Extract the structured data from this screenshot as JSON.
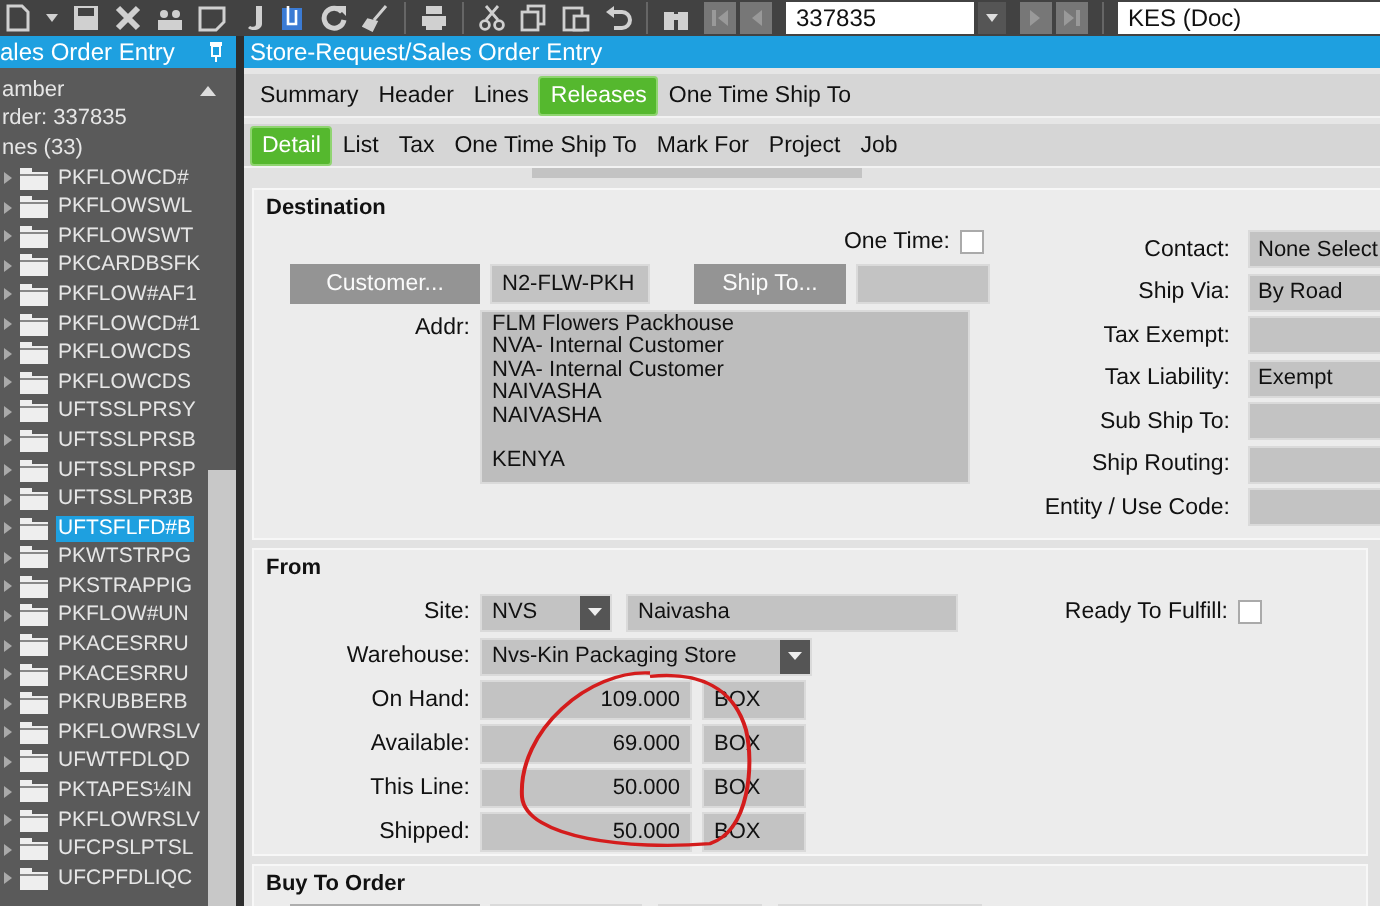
{
  "toolbar": {
    "order_number": "337835",
    "company": "KES (Doc)"
  },
  "sidebar": {
    "title": "ales Order Entry",
    "tree": [
      {
        "label": "amber",
        "children": [
          {
            "label": "rder: 337835",
            "children": [
              {
                "label": "nes (33)",
                "children": [
                  {
                    "label": "PKFLOWCD#",
                    "selected": false
                  },
                  {
                    "label": "PKFLOWSWL",
                    "selected": false
                  },
                  {
                    "label": "PKFLOWSWT",
                    "selected": false
                  },
                  {
                    "label": "PKCARDBSFK",
                    "selected": false
                  },
                  {
                    "label": "PKFLOW#AF1",
                    "selected": false
                  },
                  {
                    "label": "PKFLOWCD#1",
                    "selected": false
                  },
                  {
                    "label": "PKFLOWCDS",
                    "selected": false
                  },
                  {
                    "label": "PKFLOWCDS",
                    "selected": false
                  },
                  {
                    "label": "UFTSSLPRSY",
                    "selected": false
                  },
                  {
                    "label": "UFTSSLPRSB",
                    "selected": false
                  },
                  {
                    "label": "UFTSSLPRSP",
                    "selected": false
                  },
                  {
                    "label": "UFTSSLPR3B",
                    "selected": false
                  },
                  {
                    "label": "UFTSFLFD#B",
                    "selected": true
                  },
                  {
                    "label": "PKWTSTRPG",
                    "selected": false
                  },
                  {
                    "label": "PKSTRAPPIG",
                    "selected": false
                  },
                  {
                    "label": "PKFLOW#UN",
                    "selected": false
                  },
                  {
                    "label": "PKACESRRU",
                    "selected": false
                  },
                  {
                    "label": "PKACESRRU",
                    "selected": false
                  },
                  {
                    "label": "PKRUBBERB",
                    "selected": false
                  },
                  {
                    "label": "PKFLOWRSLV",
                    "selected": false
                  },
                  {
                    "label": "UFWTFDLQD",
                    "selected": false
                  },
                  {
                    "label": "PKTAPES½IN",
                    "selected": false
                  },
                  {
                    "label": "PKFLOWRSLV",
                    "selected": false
                  },
                  {
                    "label": "UFCPSLPTSL",
                    "selected": false
                  },
                  {
                    "label": "UFCPFDLIQC",
                    "selected": false
                  }
                ]
              }
            ]
          }
        ]
      }
    ]
  },
  "window": {
    "title": "Store-Request/Sales Order Entry"
  },
  "tabs": [
    {
      "label": "Summary",
      "selected": false
    },
    {
      "label": "Header",
      "selected": false
    },
    {
      "label": "Lines",
      "selected": false
    },
    {
      "label": "Releases",
      "selected": true
    },
    {
      "label": "One Time Ship To",
      "selected": false
    }
  ],
  "subtabs": [
    {
      "label": "Detail",
      "selected": true
    },
    {
      "label": "List",
      "selected": false
    },
    {
      "label": "Tax",
      "selected": false
    },
    {
      "label": "One Time Ship To",
      "selected": false
    },
    {
      "label": "Mark For",
      "selected": false
    },
    {
      "label": "Project",
      "selected": false
    },
    {
      "label": "Job",
      "selected": false
    }
  ],
  "destination": {
    "heading": "Destination",
    "one_time": {
      "label": "One Time:",
      "checked": false
    },
    "customer_button": {
      "label": "Customer...",
      "disabled": true
    },
    "customer_id": "N2-FLW-PKH",
    "ship_to_button": {
      "label": "Ship To...",
      "disabled": true
    },
    "address_label": "Addr:",
    "address": "FLM Flowers Packhouse\nNVA- Internal Customer\nNVA- Internal Customer\nNAIVASHA\nNAIVASHA\n\nKENYA",
    "fields": [
      {
        "label": "Contact:",
        "value": "None Select"
      },
      {
        "label": "Ship Via:",
        "value": "By Road"
      },
      {
        "label": "Tax Exempt:"
      },
      {
        "label": "Tax Liability:",
        "value": "Exempt"
      },
      {
        "label": "Sub Ship To:"
      },
      {
        "label": "Ship Routing:"
      },
      {
        "label": "Entity / Use Code:"
      }
    ]
  },
  "from": {
    "heading": "From",
    "site": {
      "label": "Site:",
      "value": "NVS",
      "description": "Naivasha"
    },
    "warehouse": {
      "label": "Warehouse:",
      "value": "Nvs-Kin Packaging Store"
    },
    "ready_to_fulfill": {
      "label": "Ready To Fulfill:",
      "checked": false
    },
    "quantities": [
      {
        "label": "On Hand:",
        "value": "109.000",
        "unit": "BOX"
      },
      {
        "label": "Available:",
        "value": "69.000",
        "unit": "BOX"
      },
      {
        "label": "This Line:",
        "value": "50.000",
        "unit": "BOX"
      },
      {
        "label": "Shipped:",
        "value": "50.000",
        "unit": "BOX"
      }
    ]
  },
  "buy_to_order": {
    "heading": "Buy To Order"
  }
}
